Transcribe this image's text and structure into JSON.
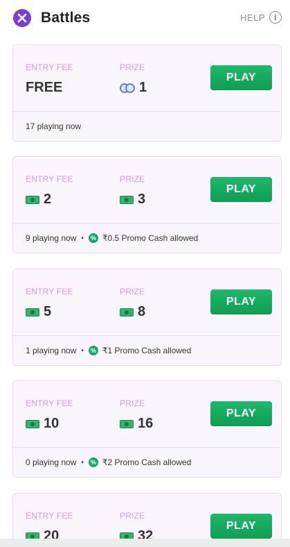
{
  "header": {
    "title": "Battles",
    "help_label": "HELP",
    "help_icon_glyph": "i"
  },
  "labels": {
    "entry_fee": "ENTRY FEE",
    "prize": "PRIZE",
    "play": "PLAY",
    "separator": "•"
  },
  "battles": [
    {
      "entry_fee": "FREE",
      "entry_icon": "none",
      "prize": "1",
      "prize_icon": "coin-icon",
      "playing": "17 playing now",
      "promo": ""
    },
    {
      "entry_fee": "2",
      "entry_icon": "cash-icon",
      "prize": "3",
      "prize_icon": "cash-icon",
      "playing": "9 playing now",
      "promo": "₹0.5 Promo Cash allowed"
    },
    {
      "entry_fee": "5",
      "entry_icon": "cash-icon",
      "prize": "8",
      "prize_icon": "cash-icon",
      "playing": "1 playing now",
      "promo": "₹1 Promo Cash allowed"
    },
    {
      "entry_fee": "10",
      "entry_icon": "cash-icon",
      "prize": "16",
      "prize_icon": "cash-icon",
      "playing": "0 playing now",
      "promo": "₹2 Promo Cash allowed"
    },
    {
      "entry_fee": "20",
      "entry_icon": "cash-icon",
      "prize": "32",
      "prize_icon": "cash-icon",
      "playing": "",
      "promo": ""
    }
  ],
  "colors": {
    "accent_purple": "#7a3fd6",
    "play_green": "#12a85e",
    "label_pink": "#d99ae3",
    "card_bg": "#faf4fc"
  }
}
